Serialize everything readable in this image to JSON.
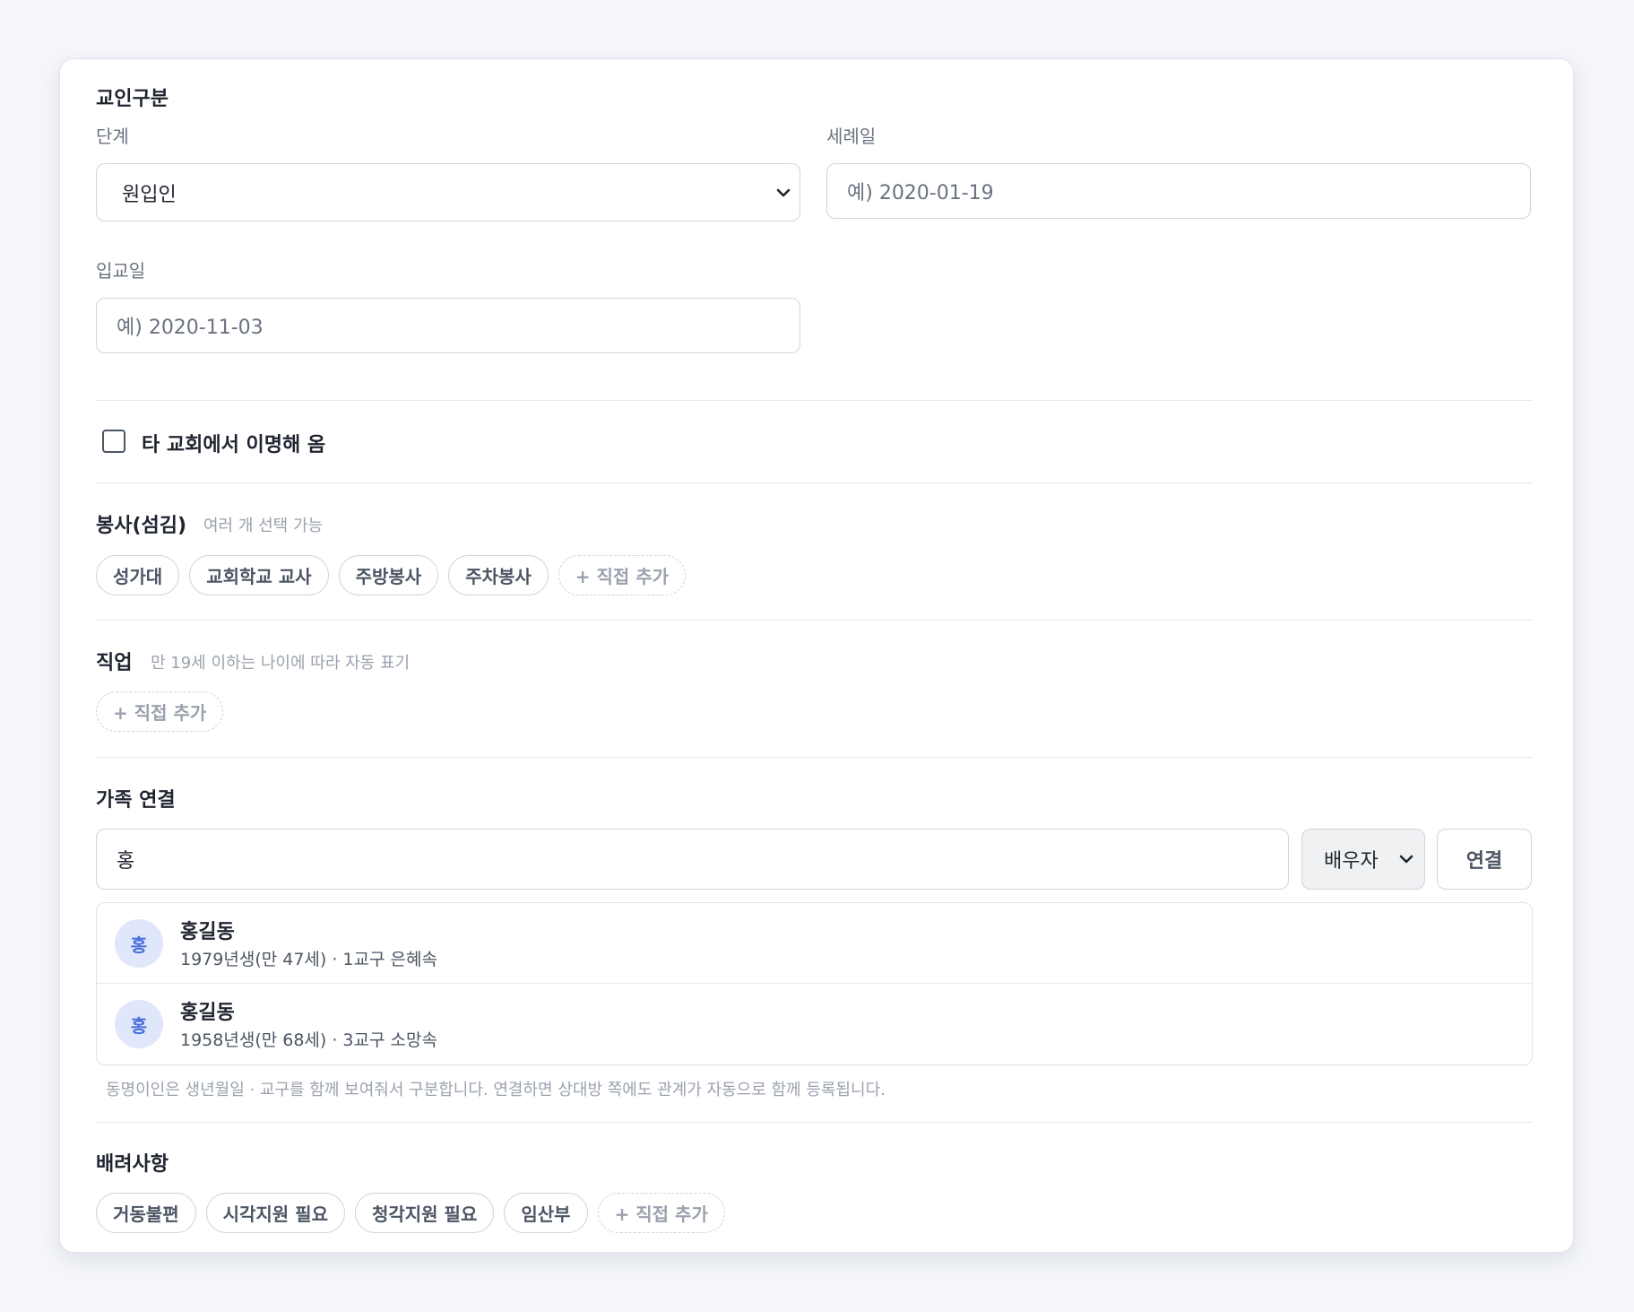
{
  "member_type": {
    "title": "교인구분",
    "stage": {
      "label": "단계",
      "value": "원입인"
    },
    "baptism_date": {
      "label": "세례일",
      "placeholder": "예) 2020-01-19"
    },
    "registration_date": {
      "label": "입교일",
      "placeholder": "예) 2020-11-03"
    }
  },
  "transfer": {
    "label": "타 교회에서 이명해 옴",
    "checked": false
  },
  "service": {
    "title": "봉사(섬김)",
    "hint": "여러 개 선택 가능",
    "chips": [
      "성가대",
      "교회학교 교사",
      "주방봉사",
      "주차봉사"
    ],
    "add_label": "+ 직접 추가"
  },
  "occupation": {
    "title": "직업",
    "hint": "만 19세 이하는 나이에 따라 자동 표기",
    "add_label": "+ 직접 추가"
  },
  "family": {
    "title": "가족 연결",
    "search_value": "홍",
    "relation_value": "배우자",
    "connect_label": "연결",
    "results": [
      {
        "avatar": "홍",
        "name": "홍길동",
        "meta": "1979년생(만 47세) · 1교구 은혜속"
      },
      {
        "avatar": "홍",
        "name": "홍길동",
        "meta": "1958년생(만 68세) · 3교구 소망속"
      }
    ],
    "note": "동명이인은 생년월일 · 교구를 함께 보여줘서 구분합니다. 연결하면 상대방 쪽에도 관계가 자동으로 함께 등록됩니다."
  },
  "considerations": {
    "title": "배려사항",
    "chips": [
      "거동불편",
      "시각지원 필요",
      "청각지원 필요",
      "임산부"
    ],
    "add_label": "+ 직접 추가"
  }
}
